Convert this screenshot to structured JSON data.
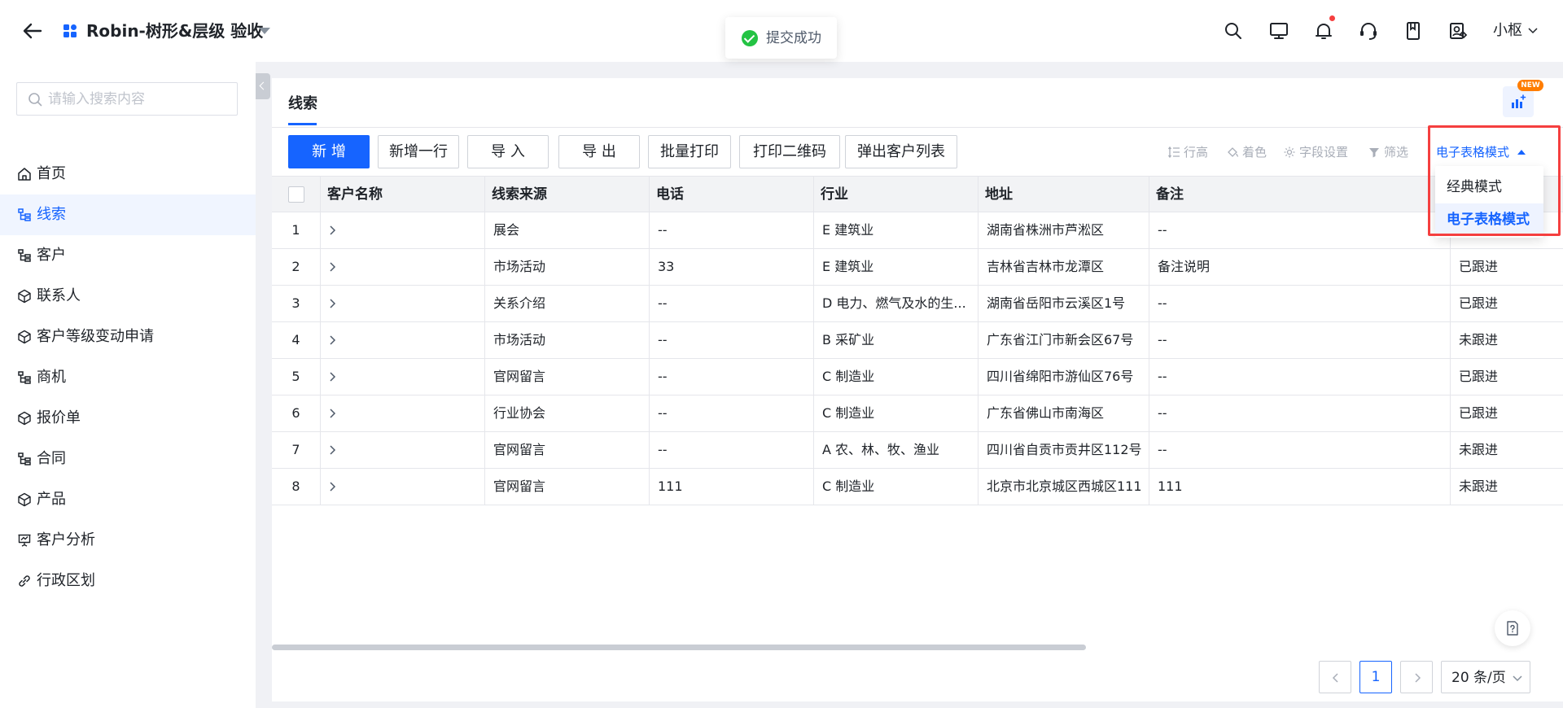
{
  "header": {
    "app_title": "Robin-树形&层级 验收",
    "toast_text": "提交成功",
    "user_name": "小枢"
  },
  "sidebar": {
    "search_placeholder": "请输入搜索内容",
    "items": [
      {
        "label": "首页",
        "icon": "home-icon",
        "active": false
      },
      {
        "label": "线索",
        "icon": "tree-icon",
        "active": true
      },
      {
        "label": "客户",
        "icon": "tree-icon",
        "active": false
      },
      {
        "label": "联系人",
        "icon": "cube-icon",
        "active": false
      },
      {
        "label": "客户等级变动申请",
        "icon": "cube-icon",
        "active": false
      },
      {
        "label": "商机",
        "icon": "tree-icon",
        "active": false
      },
      {
        "label": "报价单",
        "icon": "cube-icon",
        "active": false
      },
      {
        "label": "合同",
        "icon": "tree-icon",
        "active": false
      },
      {
        "label": "产品",
        "icon": "cube-icon",
        "active": false
      },
      {
        "label": "客户分析",
        "icon": "presentation-icon",
        "active": false
      },
      {
        "label": "行政区划",
        "icon": "link-icon",
        "active": false
      }
    ]
  },
  "main": {
    "page_title": "线索",
    "new_badge": "NEW",
    "toolbar": {
      "add": "新 增",
      "add_row": "新增一行",
      "import": "导 入",
      "export": "导 出",
      "batch_print": "批量打印",
      "print_qr": "打印二维码",
      "popup_customers": "弹出客户列表",
      "row_height": "行高",
      "coloring": "着色",
      "field_settings": "字段设置",
      "filter": "筛选",
      "mode_toggle": "电子表格模式"
    },
    "mode_menu": {
      "options": [
        "经典模式",
        "电子表格模式"
      ],
      "selected": "电子表格模式"
    },
    "table": {
      "columns": [
        "客户名称",
        "线索来源",
        "电话",
        "行业",
        "地址",
        "备注",
        ""
      ],
      "rows": [
        [
          "1",
          "",
          "展会",
          "--",
          "E 建筑业",
          "湖南省株洲市芦淞区",
          "--",
          ""
        ],
        [
          "2",
          "",
          "市场活动",
          "33",
          "E 建筑业",
          "吉林省吉林市龙潭区",
          "备注说明",
          "已跟进"
        ],
        [
          "3",
          "",
          "关系介绍",
          "--",
          "D 电力、燃气及水的生...",
          "湖南省岳阳市云溪区1号",
          "--",
          "已跟进"
        ],
        [
          "4",
          "",
          "市场活动",
          "--",
          "B 采矿业",
          "广东省江门市新会区67号",
          "--",
          "未跟进"
        ],
        [
          "5",
          "",
          "官网留言",
          "--",
          "C 制造业",
          "四川省绵阳市游仙区76号",
          "--",
          "已跟进"
        ],
        [
          "6",
          "",
          "行业协会",
          "--",
          "C 制造业",
          "广东省佛山市南海区",
          "--",
          "已跟进"
        ],
        [
          "7",
          "",
          "官网留言",
          "--",
          "A 农、林、牧、渔业",
          "四川省自贡市贡井区112号",
          "--",
          "未跟进"
        ],
        [
          "8",
          "",
          "官网留言",
          "111",
          "C 制造业",
          "北京市北京城区西城区111",
          "111",
          "未跟进"
        ]
      ]
    },
    "pagination": {
      "current_page": "1",
      "page_size": "20 条/页"
    }
  },
  "colors": {
    "primary": "#1664ff",
    "success": "#23c343",
    "danger": "#f53f3f",
    "badge": "#ff7d00"
  }
}
